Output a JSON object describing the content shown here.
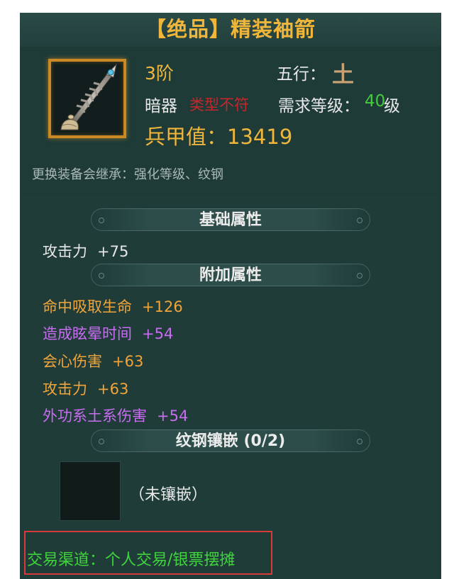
{
  "item": {
    "name": "【绝品】精装袖箭",
    "tier": "3阶",
    "element_label": "五行：",
    "element_value": "土",
    "weapon_type": "暗器",
    "type_mismatch": "类型不符",
    "req_level_label": "需求等级：",
    "req_level_value": "40",
    "req_level_unit": "级",
    "power_label": "兵甲值：",
    "power_value": "13419",
    "inherit_note": "更换装备会继承：强化等级、纹钢",
    "icon": "sleeve-arrow-icon"
  },
  "sections": {
    "basic": {
      "title": "基础属性",
      "attrs": [
        {
          "name": "攻击力",
          "value": "+75",
          "color": "#e8e8e8"
        }
      ]
    },
    "extra": {
      "title": "附加属性",
      "attrs": [
        {
          "name": "命中吸取生命",
          "value": "+126",
          "color": "#f1a43a"
        },
        {
          "name": "造成眩晕时间",
          "value": "+54",
          "color": "#c86cf2"
        },
        {
          "name": "会心伤害",
          "value": "+63",
          "color": "#f1a43a"
        },
        {
          "name": "攻击力",
          "value": "+63",
          "color": "#f1a43a"
        },
        {
          "name": "外功系土系伤害",
          "value": "+54",
          "color": "#c86cf2"
        }
      ]
    },
    "socket": {
      "title": "纹钢镶嵌 (0/2)",
      "empty_text": "（未镶嵌）"
    }
  },
  "trade": {
    "text": "交易渠道：个人交易/银票摆摊"
  },
  "colors": {
    "title": "#f0b63c",
    "panel_bg": "#1f3c39",
    "highlight_box": "#d63a3a",
    "trade_text": "#3fd43c"
  }
}
